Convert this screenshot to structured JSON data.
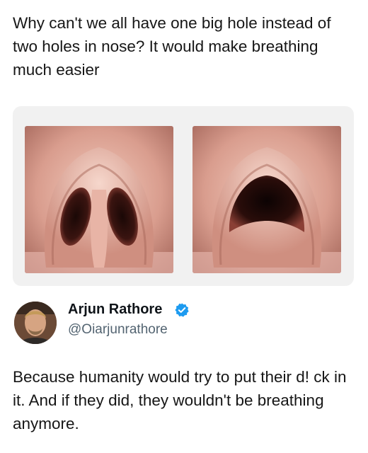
{
  "post": {
    "text": "Why can't we all have one big hole instead of two holes in nose? It would make breathing much easier"
  },
  "images": [
    {
      "name": "nose-two-nostrils",
      "icon": "nose-photo"
    },
    {
      "name": "nose-one-nostril",
      "icon": "nose-photo"
    }
  ],
  "reply": {
    "display_name": "Arjun Rathore",
    "verified": true,
    "verified_color": "#1d9bf0",
    "handle": "@Oiarjunrathore",
    "text": "Because humanity would try to put their d! ck in it. And if they did, they wouldn't be breathing anymore."
  },
  "colors": {
    "text": "#161616",
    "handle": "#536471",
    "card_bg": "#f1f1f1"
  }
}
